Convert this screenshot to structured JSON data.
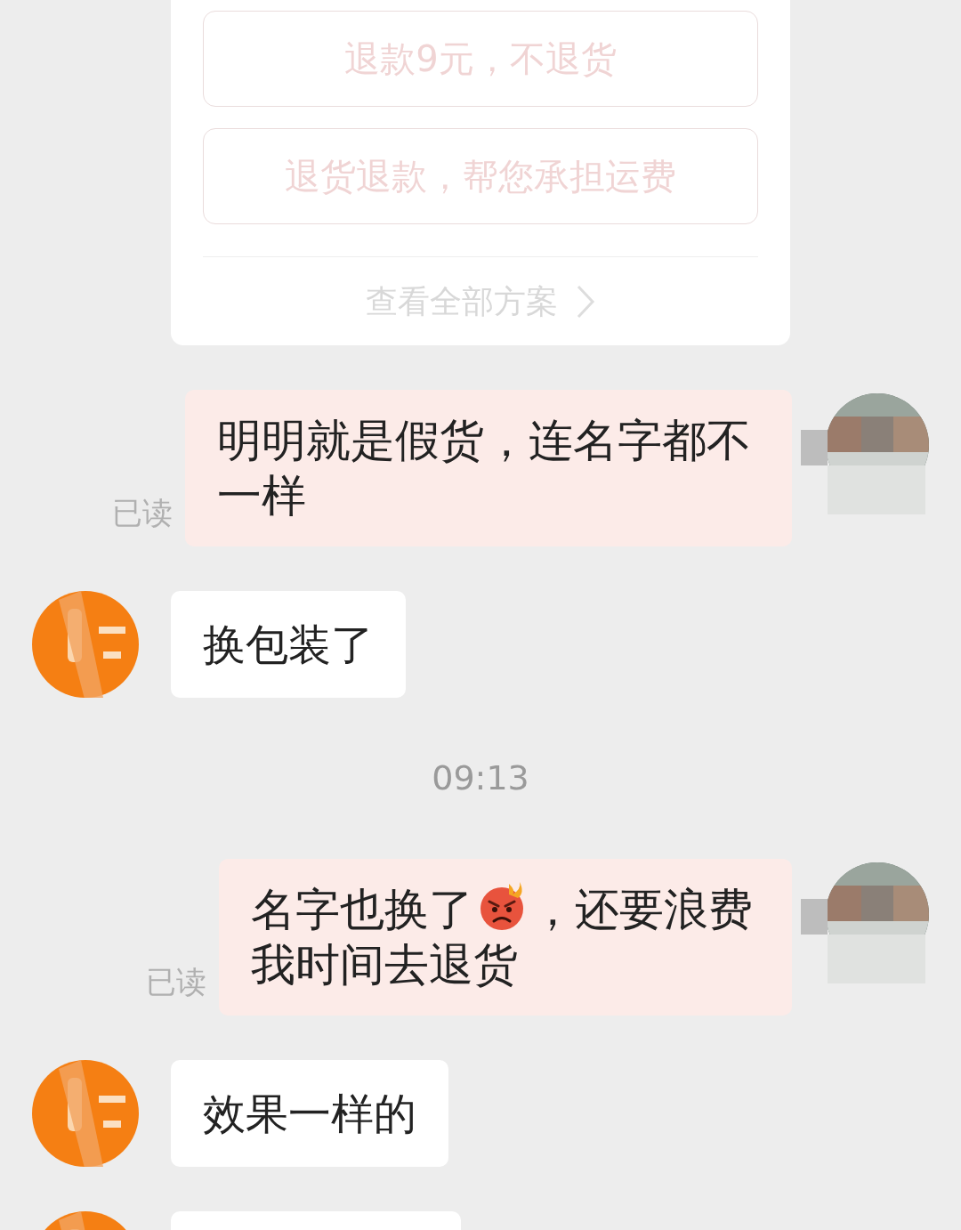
{
  "refund_card": {
    "options": [
      {
        "label": "退款9元，不退货"
      },
      {
        "label": "退货退款，帮您承担运费"
      }
    ],
    "view_all": "查看全部方案"
  },
  "messages": [
    {
      "kind": "sent",
      "parts": [
        "明明就是假货，连名字都不一样"
      ],
      "status": "已读"
    },
    {
      "kind": "received",
      "parts": [
        "换包装了"
      ]
    },
    {
      "kind": "time",
      "text": "09:13"
    },
    {
      "kind": "sent",
      "parts": [
        "名字也换了",
        "，还要浪费我时间去退货"
      ],
      "status": "已读"
    },
    {
      "kind": "received",
      "parts": [
        "效果一样的"
      ]
    },
    {
      "kind": "received"
    }
  ]
}
